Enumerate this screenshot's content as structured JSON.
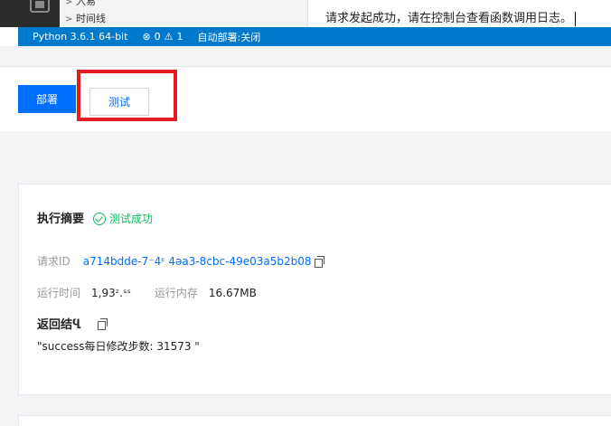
{
  "explorer": {
    "items": [
      {
        "label": "入易"
      },
      {
        "label": "时间线"
      }
    ]
  },
  "console": {
    "message": "请求发起成功，请在控制台查看函数调用日志。"
  },
  "statusbar": {
    "python": "Python 3.6.1 64-bit",
    "errors": "0",
    "warnings": "1",
    "autodeploy": "自动部署:关闭"
  },
  "actions": {
    "deploy_label": "部署",
    "test_label": "测试"
  },
  "result": {
    "summary_title": "执行摘要",
    "status": "测试成功",
    "request_id_label": "请求ID",
    "request_id": "a714bdde-7⁻4ᵋ 4ǝa3-8cbc-49e03a5b2b08",
    "runtime_label": "运行时间",
    "runtime": "1,93ᶻ.ˢˢ",
    "memory_label": "运行内存",
    "memory": "16.67MB",
    "return_title": "返回结Ⴁ",
    "return_value": "\"success每日修改步数: 31573  \""
  },
  "colors": {
    "primary": "#006eff",
    "statusbar": "#007acc",
    "success": "#0abf5b",
    "highlight": "#e31b23"
  },
  "icons": [
    "files-icon",
    "chevron-right-icon",
    "error-icon",
    "warning-icon",
    "check-circle-icon",
    "copy-icon"
  ]
}
